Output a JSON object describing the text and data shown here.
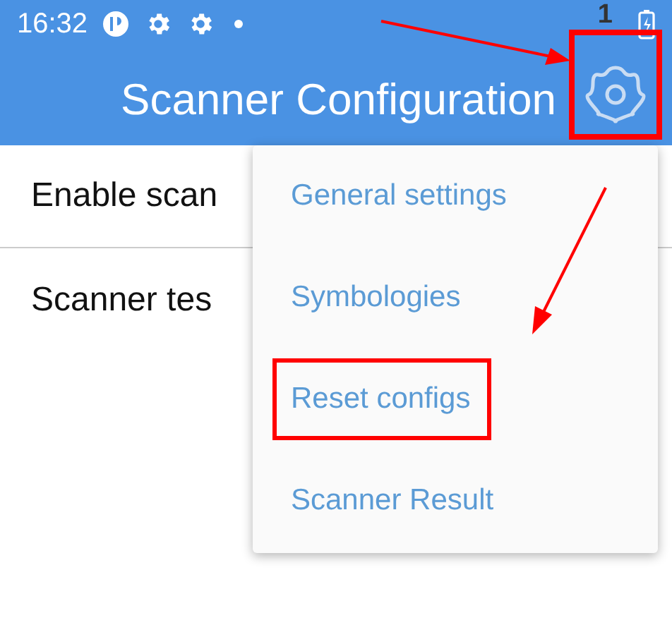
{
  "status_bar": {
    "time": "16:32",
    "right_text": "1"
  },
  "app_bar": {
    "title": "Scanner Configuration",
    "settings_button": {
      "annotated": true
    }
  },
  "list": [
    {
      "label": "Enable scan"
    },
    {
      "label": "Scanner tes"
    }
  ],
  "menu": {
    "items": [
      {
        "label": "General settings",
        "annotated": false
      },
      {
        "label": "Symbologies",
        "annotated": false
      },
      {
        "label": "Reset configs",
        "annotated": true
      },
      {
        "label": "Scanner Result",
        "annotated": false
      }
    ]
  }
}
